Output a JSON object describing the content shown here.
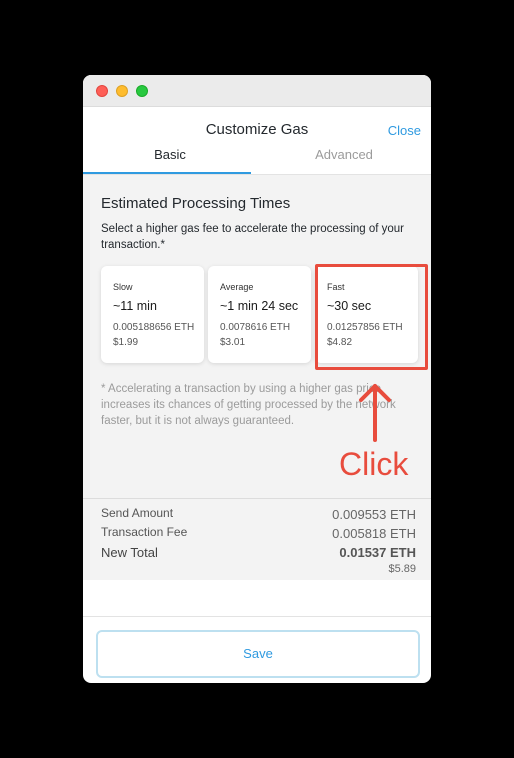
{
  "window": {
    "controls": [
      "close",
      "minimize",
      "maximize"
    ]
  },
  "header": {
    "title": "Customize Gas",
    "close_label": "Close",
    "tabs": [
      {
        "label": "Basic",
        "active": true
      },
      {
        "label": "Advanced",
        "active": false
      }
    ]
  },
  "main": {
    "title": "Estimated Processing Times",
    "subtitle": "Select a higher gas fee to accelerate the processing of your transaction.*",
    "options": [
      {
        "label": "Slow",
        "time": "~11 min",
        "eth": "0.005188656 ETH",
        "usd": "$1.99"
      },
      {
        "label": "Average",
        "time": "~1 min 24 sec",
        "eth": "0.0078616 ETH",
        "usd": "$3.01"
      },
      {
        "label": "Fast",
        "time": "~30 sec",
        "eth": "0.01257856 ETH",
        "usd": "$4.82"
      }
    ],
    "note": "* Accelerating a transaction by using a higher gas price increases its chances of getting processed by the network faster, but it is not always guaranteed."
  },
  "totals": {
    "send_amount_label": "Send Amount",
    "send_amount_value": "0.009553 ETH",
    "fee_label": "Transaction Fee",
    "fee_value": "0.005818 ETH",
    "total_label": "New Total",
    "total_value": "0.01537 ETH",
    "total_usd": "$5.89"
  },
  "footer": {
    "save_label": "Save"
  },
  "annotation": {
    "label": "Click",
    "color": "#e84c3d"
  },
  "colors": {
    "accent": "#2f9ae0",
    "annotation": "#e84c3d",
    "panel_bg": "#f3f3f3"
  }
}
